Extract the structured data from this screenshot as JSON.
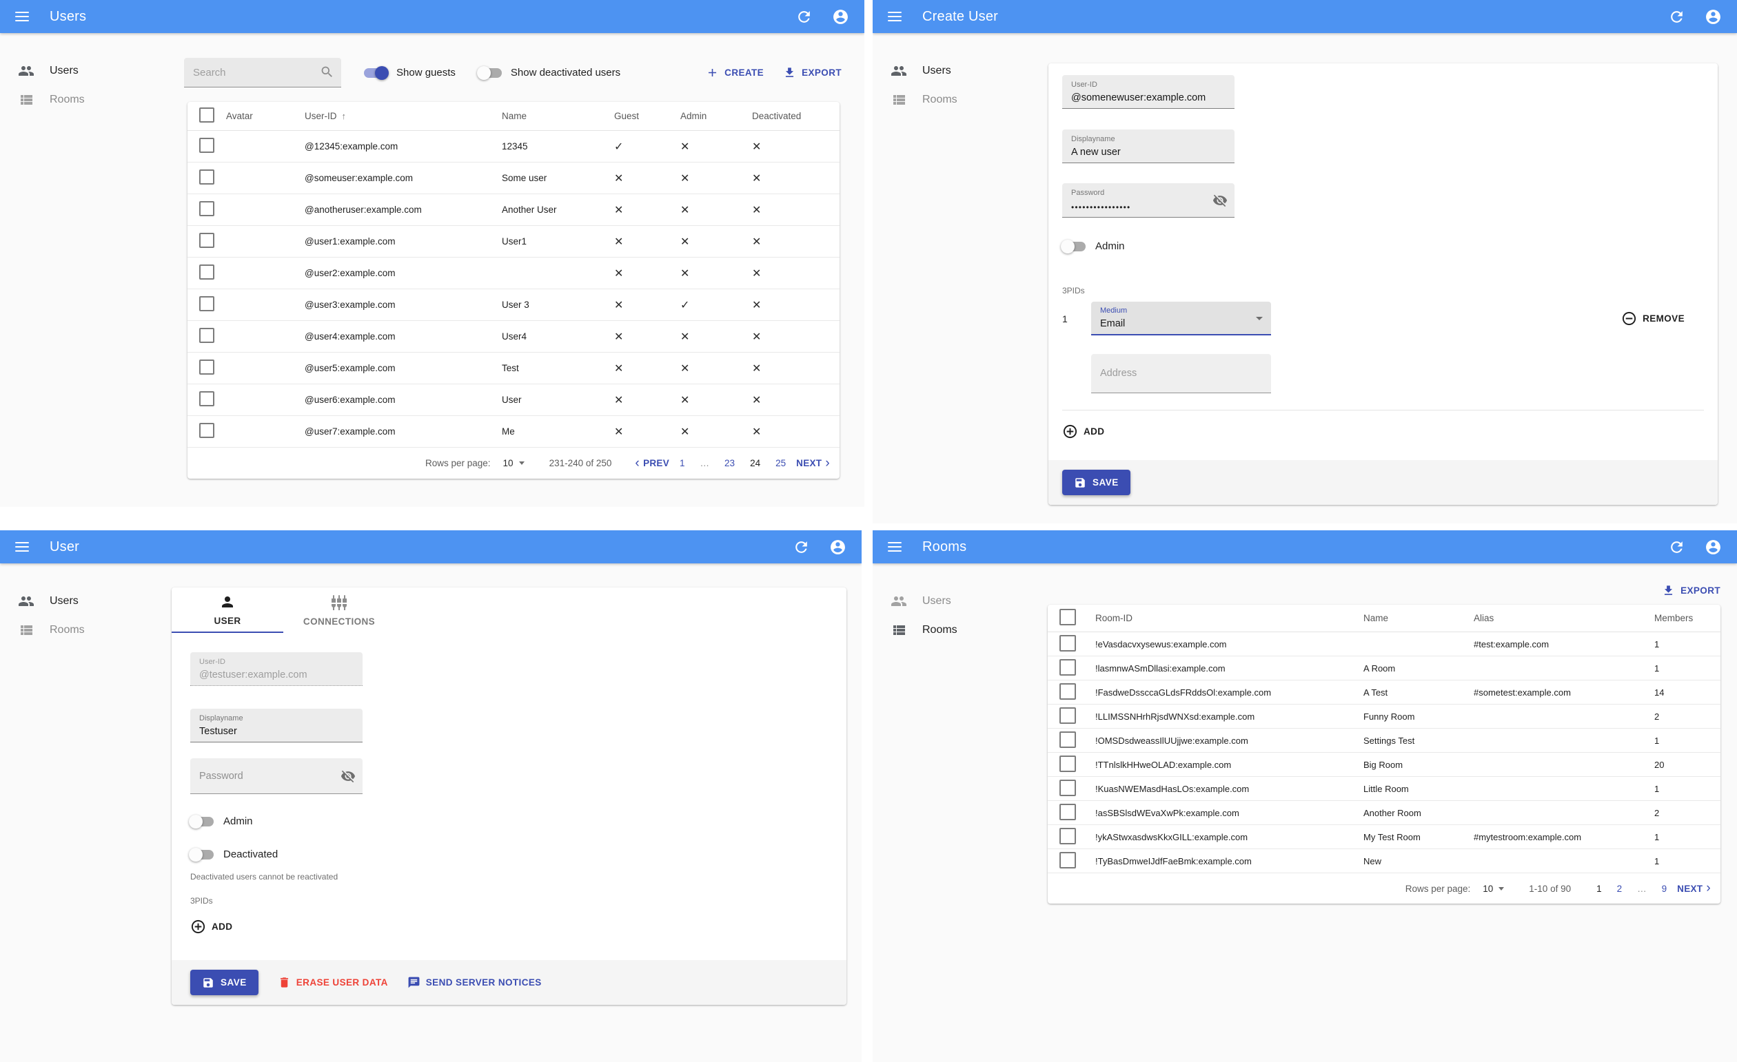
{
  "colors": {
    "appbar_blue": "#4d93f2",
    "primary_indigo": "#3b4db2",
    "danger_red": "#ee4237",
    "page_bg": "#fafafa"
  },
  "glyphs": {
    "check": "✓",
    "cross": "✕",
    "sort_up": "↑",
    "prev_chev": "‹",
    "next_chev": "›"
  },
  "users_panel": {
    "appbar_title": "Users",
    "nav": {
      "users": "Users",
      "rooms": "Rooms"
    },
    "search_placeholder": "Search",
    "show_guests_label": "Show guests",
    "show_deactivated_label": "Show deactivated users",
    "create_label": "CREATE",
    "export_label": "EXPORT",
    "table": {
      "headers": {
        "avatar": "Avatar",
        "user_id": "User-ID",
        "name": "Name",
        "guest": "Guest",
        "admin": "Admin",
        "deactivated": "Deactivated"
      },
      "rows": [
        {
          "user_id": "@12345:example.com",
          "name": "12345",
          "guest": "check",
          "admin": "cross",
          "deactivated": "cross"
        },
        {
          "user_id": "@someuser:example.com",
          "name": "Some user",
          "guest": "cross",
          "admin": "cross",
          "deactivated": "cross"
        },
        {
          "user_id": "@anotheruser:example.com",
          "name": "Another User",
          "guest": "cross",
          "admin": "cross",
          "deactivated": "cross"
        },
        {
          "user_id": "@user1:example.com",
          "name": "User1",
          "guest": "cross",
          "admin": "cross",
          "deactivated": "cross"
        },
        {
          "user_id": "@user2:example.com",
          "name": "",
          "guest": "cross",
          "admin": "cross",
          "deactivated": "cross"
        },
        {
          "user_id": "@user3:example.com",
          "name": "User 3",
          "guest": "cross",
          "admin": "check",
          "deactivated": "cross"
        },
        {
          "user_id": "@user4:example.com",
          "name": "User4",
          "guest": "cross",
          "admin": "cross",
          "deactivated": "cross"
        },
        {
          "user_id": "@user5:example.com",
          "name": "Test",
          "guest": "cross",
          "admin": "cross",
          "deactivated": "cross"
        },
        {
          "user_id": "@user6:example.com",
          "name": "User",
          "guest": "cross",
          "admin": "cross",
          "deactivated": "cross"
        },
        {
          "user_id": "@user7:example.com",
          "name": "Me",
          "guest": "cross",
          "admin": "cross",
          "deactivated": "cross"
        }
      ]
    },
    "pagination": {
      "rows_per_page_label": "Rows per page:",
      "rows_per_page": "10",
      "range": "231-240 of 250",
      "prev_label": "PREV",
      "next_label": "NEXT",
      "pages": [
        {
          "label": "1",
          "state": "link"
        },
        {
          "label": "…",
          "state": "ellipsis"
        },
        {
          "label": "23",
          "state": "link"
        },
        {
          "label": "24",
          "state": "current"
        },
        {
          "label": "25",
          "state": "link"
        }
      ]
    }
  },
  "create_user_panel": {
    "appbar_title": "Create User",
    "nav": {
      "users": "Users",
      "rooms": "Rooms"
    },
    "fields": {
      "user_id_label": "User-ID",
      "user_id_value": "@somenewuser:example.com",
      "displayname_label": "Displayname",
      "displayname_value": "A new user",
      "password_label": "Password",
      "password_dots": "••••••••••••••••",
      "admin_label": "Admin",
      "threepids_label": "3PIDs",
      "threepid_index": "1",
      "medium_label": "Medium",
      "medium_value": "Email",
      "remove_label": "REMOVE",
      "address_placeholder": "Address",
      "add_label": "ADD",
      "save_label": "SAVE"
    }
  },
  "user_panel": {
    "appbar_title": "User",
    "nav": {
      "users": "Users",
      "rooms": "Rooms"
    },
    "tabs": {
      "user": "USER",
      "connections": "CONNECTIONS"
    },
    "fields": {
      "user_id_label": "User-ID",
      "user_id_value": "@testuser:example.com",
      "displayname_label": "Displayname",
      "displayname_value": "Testuser",
      "password_placeholder": "Password",
      "admin_label": "Admin",
      "deactivated_label": "Deactivated",
      "deactivated_helper": "Deactivated users cannot be reactivated",
      "threepids_label": "3PIDs",
      "add_label": "ADD"
    },
    "actions": {
      "save": "SAVE",
      "erase": "ERASE USER DATA",
      "notices": "SEND SERVER NOTICES"
    }
  },
  "rooms_panel": {
    "appbar_title": "Rooms",
    "nav": {
      "users": "Users",
      "rooms": "Rooms"
    },
    "export_label": "EXPORT",
    "table": {
      "headers": {
        "room_id": "Room-ID",
        "name": "Name",
        "alias": "Alias",
        "members": "Members"
      },
      "rows": [
        {
          "room_id": "!eVasdacvxysewus:example.com",
          "name": "",
          "alias": "#test:example.com",
          "members": "1"
        },
        {
          "room_id": "!lasmnwASmDllasi:example.com",
          "name": "A Room",
          "alias": "",
          "members": "1"
        },
        {
          "room_id": "!FasdweDssccaGLdsFRddsOl:example.com",
          "name": "A Test",
          "alias": "#sometest:example.com",
          "members": "14"
        },
        {
          "room_id": "!LLIMSSNHrhRjsdWNXsd:example.com",
          "name": "Funny Room",
          "alias": "",
          "members": "2"
        },
        {
          "room_id": "!OMSDsdweassIlUUjjwe:example.com",
          "name": "Settings Test",
          "alias": "",
          "members": "1"
        },
        {
          "room_id": "!TTnlslkHHweOLAD:example.com",
          "name": "Big Room",
          "alias": "",
          "members": "20"
        },
        {
          "room_id": "!KuasNWEMasdHasLOs:example.com",
          "name": "Little Room",
          "alias": "",
          "members": "1"
        },
        {
          "room_id": "!asSBSlsdWEvaXwPk:example.com",
          "name": "Another Room",
          "alias": "",
          "members": "2"
        },
        {
          "room_id": "!ykAStwxasdwsKkxGILL:example.com",
          "name": "My Test Room",
          "alias": "#mytestroom:example.com",
          "members": "1"
        },
        {
          "room_id": "!TyBasDmweIJdfFaeBmk:example.com",
          "name": "New",
          "alias": "",
          "members": "1"
        }
      ]
    },
    "pagination": {
      "rows_per_page_label": "Rows per page:",
      "rows_per_page": "10",
      "range": "1-10 of 90",
      "next_label": "NEXT",
      "pages": [
        {
          "label": "1",
          "state": "current"
        },
        {
          "label": "2",
          "state": "link"
        },
        {
          "label": "…",
          "state": "ellipsis"
        },
        {
          "label": "9",
          "state": "link"
        }
      ]
    }
  }
}
